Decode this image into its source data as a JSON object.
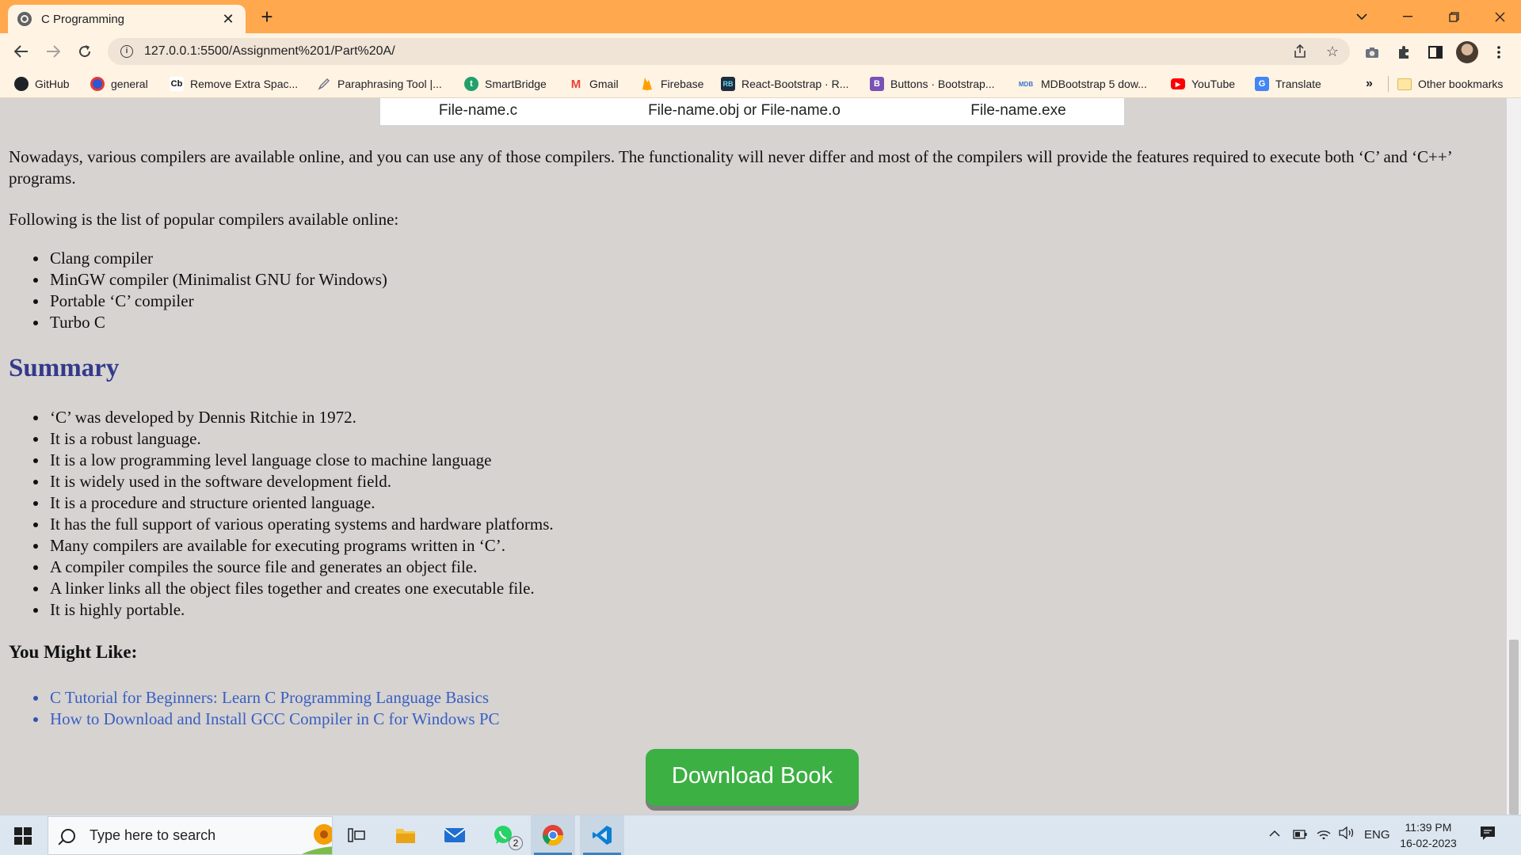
{
  "browser": {
    "tab_title": "C Programming",
    "new_tab_symbol": "+",
    "url": "127.0.0.1:5500/Assignment%201/Part%20A/",
    "bookmarks": [
      {
        "label": "GitHub",
        "icon": "github-icon",
        "color": "#1f2328",
        "glyph": ""
      },
      {
        "label": "general",
        "icon": "general-icon",
        "color": "#2f55d4",
        "glyph": ""
      },
      {
        "label": "Remove Extra Spac...",
        "icon": "cb-icon",
        "color": "#ffffff",
        "glyph": "Cb"
      },
      {
        "label": "Paraphrasing Tool |...",
        "icon": "pen-icon",
        "color": "#6b7280",
        "glyph": ""
      },
      {
        "label": "SmartBridge",
        "icon": "smartbridge-icon",
        "color": "#22a06b",
        "glyph": "t"
      },
      {
        "label": "Gmail",
        "icon": "gmail-icon",
        "color": "#ea4335",
        "glyph": "M"
      },
      {
        "label": "Firebase",
        "icon": "firebase-icon",
        "color": "#ffca28",
        "glyph": ""
      },
      {
        "label": "React-Bootstrap · R...",
        "icon": "react-bootstrap-icon",
        "color": "#1f2d3d",
        "glyph": "RB"
      },
      {
        "label": "Buttons · Bootstrap...",
        "icon": "bootstrap-icon",
        "color": "#7952b3",
        "glyph": "B"
      },
      {
        "label": "MDBootstrap 5 dow...",
        "icon": "mdb-icon",
        "color": "#3b71ca",
        "glyph": "MDB"
      },
      {
        "label": "YouTube",
        "icon": "youtube-icon",
        "color": "#ff0000",
        "glyph": "▶"
      },
      {
        "label": "Translate",
        "icon": "translate-icon",
        "color": "#4285f4",
        "glyph": "G"
      }
    ],
    "more_bookmarks": "»",
    "other_bookmarks": "Other bookmarks"
  },
  "page": {
    "table_row": [
      "File-name.c",
      "File-name.obj or File-name.o",
      "File-name.exe"
    ],
    "para1": "Nowadays, various compilers are available online, and you can use any of those compilers. The functionality will never differ and most of the compilers will provide the features required to execute both ‘C’ and ‘C++’ programs.",
    "para2": "Following is the list of popular compilers available online:",
    "compilers": [
      "Clang compiler",
      "MinGW compiler (Minimalist GNU for Windows)",
      "Portable ‘C’ compiler",
      "Turbo C"
    ],
    "summary_heading": "Summary",
    "summary": [
      "‘C’ was developed by Dennis Ritchie in 1972.",
      "It is a robust language.",
      "It is a low programming level language close to machine language",
      "It is widely used in the software development field.",
      "It is a procedure and structure oriented language.",
      "It has the full support of various operating systems and hardware platforms.",
      "Many compilers are available for executing programs written in ‘C’.",
      "A compiler compiles the source file and generates an object file.",
      "A linker links all the object files together and creates one executable file.",
      "It is highly portable."
    ],
    "like_heading": "You Might Like:",
    "links": [
      "C Tutorial for Beginners: Learn C Programming Language Basics",
      "How to Download and Install GCC Compiler in C for Windows PC"
    ],
    "download_button": "Download Book"
  },
  "taskbar": {
    "search_placeholder": "Type here to search",
    "whatsapp_badge": "2",
    "language": "ENG",
    "time": "11:39 PM",
    "date": "16-02-2023"
  }
}
